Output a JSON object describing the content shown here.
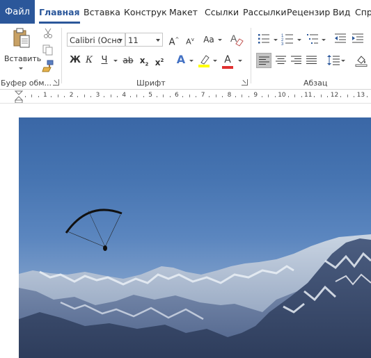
{
  "tabs": {
    "file": "Файл",
    "home": "Главная",
    "insert": "Вставка",
    "design": "Конструк",
    "layout": "Макет",
    "references": "Ссылки",
    "mailings": "Рассылки",
    "review": "Рецензир",
    "view": "Вид",
    "help": "Спр"
  },
  "clipboard": {
    "paste_label": "Вставить",
    "group_label": "Буфер обм..."
  },
  "font": {
    "name": "Calibri (Осно",
    "size": "11",
    "group_label": "Шрифт",
    "bold": "Ж",
    "italic": "К",
    "underline": "Ч",
    "strike": "ab",
    "subscript": "x",
    "superscript": "x",
    "sub_mark": "2",
    "super_mark": "2",
    "grow": "A",
    "shrink": "A",
    "case": "Aa",
    "text_effects": "A",
    "font_color": "A"
  },
  "paragraph": {
    "group_label": "Абзац"
  },
  "ruler": {
    "numbers": [
      "1",
      "2",
      "3",
      "4",
      "5",
      "6",
      "7",
      "8",
      "9",
      "10",
      "11",
      "12",
      "13"
    ]
  },
  "colors": {
    "accent": "#2b579a",
    "highlight": "#ffff00",
    "font_color": "#e03030"
  }
}
